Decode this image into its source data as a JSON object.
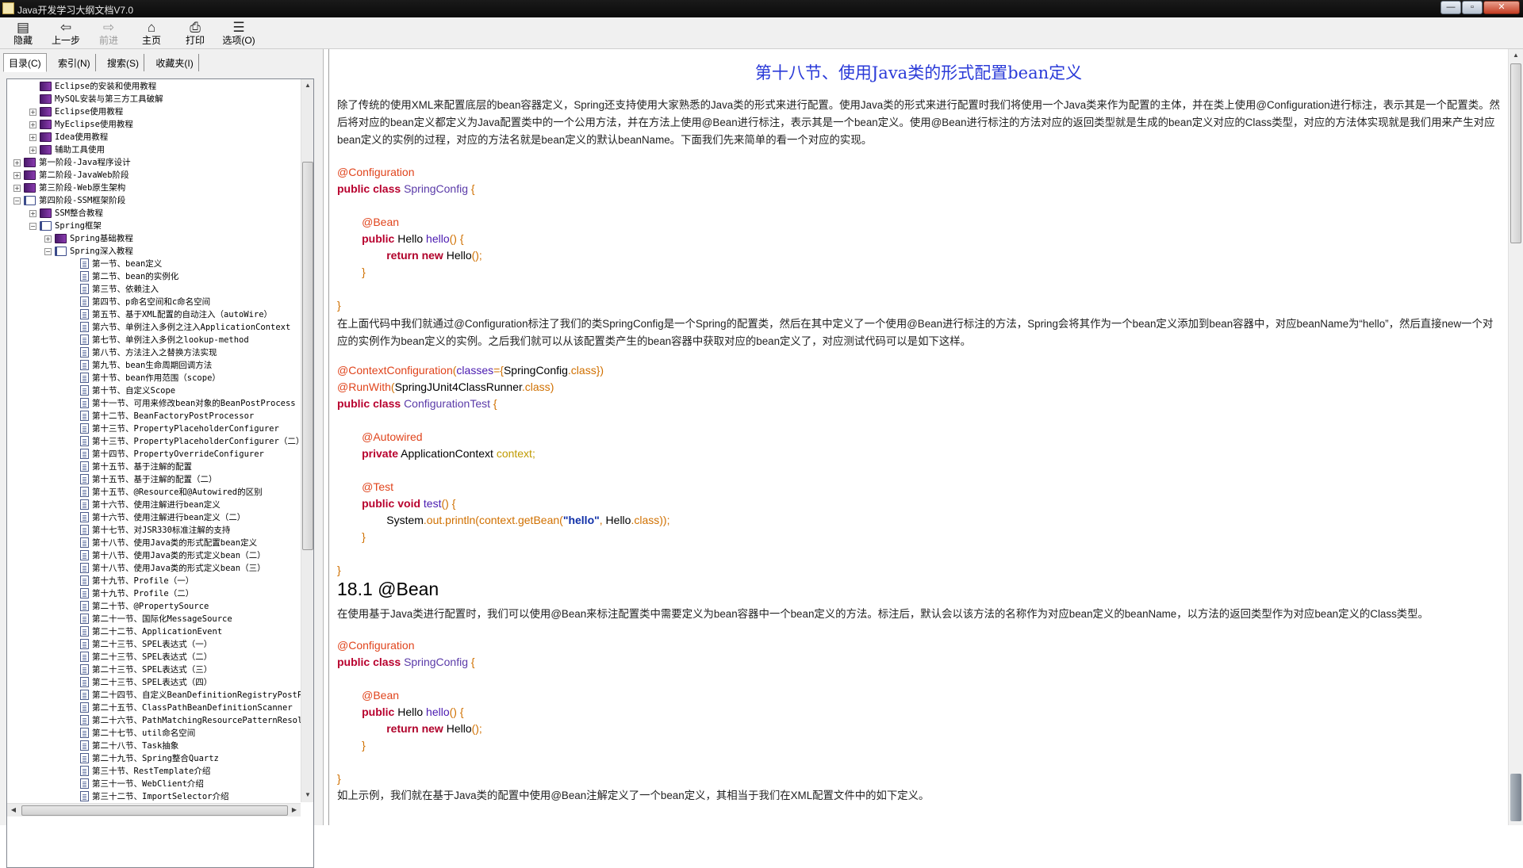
{
  "window": {
    "title": "Java开发学习大纲文档V7.0",
    "min": "—",
    "max": "▫",
    "close": "✕"
  },
  "toolbar": [
    {
      "label": "隐藏",
      "icon": "hide-icon",
      "glyph": "▤"
    },
    {
      "label": "上一步",
      "icon": "back-arrow-icon",
      "glyph": "⇦"
    },
    {
      "label": "前进",
      "icon": "forward-arrow-icon",
      "glyph": "⇨"
    },
    {
      "label": "主页",
      "icon": "home-icon",
      "glyph": "⌂"
    },
    {
      "label": "打印",
      "icon": "print-icon",
      "glyph": "⎙"
    },
    {
      "label": "选项(O)",
      "icon": "options-icon",
      "glyph": "☰"
    }
  ],
  "tabs": [
    "目录(C)",
    "索引(N)",
    "搜索(S)",
    "收藏夹(I)"
  ],
  "tree": [
    {
      "label": "Eclipse的安装和使用教程",
      "level": 2,
      "type": "book",
      "expander": ""
    },
    {
      "label": "MySQL安装与第三方工具破解",
      "level": 2,
      "type": "book",
      "expander": ""
    },
    {
      "label": "Eclipse使用教程",
      "level": 2,
      "type": "book",
      "expander": "+"
    },
    {
      "label": "MyEclipse使用教程",
      "level": 2,
      "type": "book",
      "expander": "+"
    },
    {
      "label": "Idea使用教程",
      "level": 2,
      "type": "book",
      "expander": "+"
    },
    {
      "label": "辅助工具使用",
      "level": 2,
      "type": "book",
      "expander": "+"
    },
    {
      "label": "第一阶段-Java程序设计",
      "level": 1,
      "type": "book",
      "expander": "+"
    },
    {
      "label": "第二阶段-JavaWeb阶段",
      "level": 1,
      "type": "book",
      "expander": "+"
    },
    {
      "label": "第三阶段-Web原生架构",
      "level": 1,
      "type": "book",
      "expander": "+"
    },
    {
      "label": "第四阶段-SSM框架阶段",
      "level": 1,
      "type": "open",
      "expander": "−"
    },
    {
      "label": "SSM整合教程",
      "level": 2,
      "type": "book",
      "expander": "+"
    },
    {
      "label": "Spring框架",
      "level": 2,
      "type": "open",
      "expander": "−"
    },
    {
      "label": "Spring基础教程",
      "level": 3,
      "type": "book",
      "expander": "+"
    },
    {
      "label": "Spring深入教程",
      "level": 3,
      "type": "open",
      "expander": "−"
    },
    {
      "label": "第一节、bean定义",
      "level": 4,
      "type": "page"
    },
    {
      "label": "第二节、bean的实例化",
      "level": 4,
      "type": "page"
    },
    {
      "label": "第三节、依赖注入",
      "level": 4,
      "type": "page"
    },
    {
      "label": "第四节、p命名空间和c命名空间",
      "level": 4,
      "type": "page"
    },
    {
      "label": "第五节、基于XML配置的自动注入（autoWire）",
      "level": 4,
      "type": "page"
    },
    {
      "label": "第六节、单例注入多例之注入ApplicationContext",
      "level": 4,
      "type": "page"
    },
    {
      "label": "第七节、单例注入多例之lookup-method",
      "level": 4,
      "type": "page"
    },
    {
      "label": "第八节、方法注入之替换方法实现",
      "level": 4,
      "type": "page"
    },
    {
      "label": "第九节、bean生命周期回调方法",
      "level": 4,
      "type": "page"
    },
    {
      "label": "第十节、bean作用范围（scope）",
      "level": 4,
      "type": "page"
    },
    {
      "label": "第十节、自定义Scope",
      "level": 4,
      "type": "page"
    },
    {
      "label": "第十一节、可用来修改bean对象的BeanPostProcess",
      "level": 4,
      "type": "page"
    },
    {
      "label": "第十二节、BeanFactoryPostProcessor",
      "level": 4,
      "type": "page"
    },
    {
      "label": "第十三节、PropertyPlaceholderConfigurer",
      "level": 4,
      "type": "page"
    },
    {
      "label": "第十三节、PropertyPlaceholderConfigurer（二）",
      "level": 4,
      "type": "page"
    },
    {
      "label": "第十四节、PropertyOverrideConfigurer",
      "level": 4,
      "type": "page"
    },
    {
      "label": "第十五节、基于注解的配置",
      "level": 4,
      "type": "page"
    },
    {
      "label": "第十五节、基于注解的配置（二）",
      "level": 4,
      "type": "page"
    },
    {
      "label": "第十五节、@Resource和@Autowired的区别",
      "level": 4,
      "type": "page"
    },
    {
      "label": "第十六节、使用注解进行bean定义",
      "level": 4,
      "type": "page"
    },
    {
      "label": "第十六节、使用注解进行bean定义（二）",
      "level": 4,
      "type": "page"
    },
    {
      "label": "第十七节、对JSR330标准注解的支持",
      "level": 4,
      "type": "page"
    },
    {
      "label": "第十八节、使用Java类的形式配置bean定义",
      "level": 4,
      "type": "page"
    },
    {
      "label": "第十八节、使用Java类的形式定义bean（二）",
      "level": 4,
      "type": "page"
    },
    {
      "label": "第十八节、使用Java类的形式定义bean（三）",
      "level": 4,
      "type": "page"
    },
    {
      "label": "第十九节、Profile（一）",
      "level": 4,
      "type": "page"
    },
    {
      "label": "第十九节、Profile（二）",
      "level": 4,
      "type": "page"
    },
    {
      "label": "第二十节、@PropertySource",
      "level": 4,
      "type": "page"
    },
    {
      "label": "第二十一节、国际化MessageSource",
      "level": 4,
      "type": "page"
    },
    {
      "label": "第二十二节、ApplicationEvent",
      "level": 4,
      "type": "page"
    },
    {
      "label": "第二十三节、SPEL表达式（一）",
      "level": 4,
      "type": "page"
    },
    {
      "label": "第二十三节、SPEL表达式（二）",
      "level": 4,
      "type": "page"
    },
    {
      "label": "第二十三节、SPEL表达式（三）",
      "level": 4,
      "type": "page"
    },
    {
      "label": "第二十三节、SPEL表达式（四）",
      "level": 4,
      "type": "page"
    },
    {
      "label": "第二十四节、自定义BeanDefinitionRegistryPostP",
      "level": 4,
      "type": "page"
    },
    {
      "label": "第二十五节、ClassPathBeanDefinitionScanner",
      "level": 4,
      "type": "page"
    },
    {
      "label": "第二十六节、PathMatchingResourcePatternResolv",
      "level": 4,
      "type": "page"
    },
    {
      "label": "第二十七节、util命名空间",
      "level": 4,
      "type": "page"
    },
    {
      "label": "第二十八节、Task抽象",
      "level": 4,
      "type": "page"
    },
    {
      "label": "第二十九节、Spring整合Quartz",
      "level": 4,
      "type": "page"
    },
    {
      "label": "第三十节、RestTemplate介绍",
      "level": 4,
      "type": "page"
    },
    {
      "label": "第三十一节、WebClient介绍",
      "level": 4,
      "type": "page"
    },
    {
      "label": "第三十二节、ImportSelector介绍",
      "level": 4,
      "type": "page"
    }
  ],
  "content": {
    "title": "第十八节、使用Java类的形式配置bean定义",
    "para1": "除了传统的使用XML来配置底层的bean容器定义，Spring还支持使用大家熟悉的Java类的形式来进行配置。使用Java类的形式来进行配置时我们将使用一个Java类来作为配置的主体，并在类上使用@Configuration进行标注，表示其是一个配置类。然后将对应的bean定义都定义为Java配置类中的一个公用方法，并在方法上使用@Bean进行标注，表示其是一个bean定义。使用@Bean进行标注的方法对应的返回类型就是生成的bean定义对应的Class类型，对应的方法体实现就是我们用来产生对应bean定义的实例的过程，对应的方法名就是bean定义的默认beanName。下面我们先来简单的看一个对应的实现。",
    "para2": "在上面代码中我们就通过@Configuration标注了我们的类SpringConfig是一个Spring的配置类，然后在其中定义了一个使用@Bean进行标注的方法，Spring会将其作为一个bean定义添加到bean容器中，对应beanName为“hello”，然后直接new一个对应的实例作为bean定义的实例。之后我们就可以从该配置类产生的bean容器中获取对应的bean定义了，对应测试代码可以是如下这样。",
    "h2": "18.1 @Bean",
    "para3": "在使用基于Java类进行配置时，我们可以使用@Bean来标注配置类中需要定义为bean容器中一个bean定义的方法。标注后，默认会以该方法的名称作为对应bean定义的beanName，以方法的返回类型作为对应bean定义的Class类型。",
    "para4": "如上示例，我们就在基于Java类的配置中使用@Bean注解定义了一个bean定义，其相当于我们在XML配置文件中的如下定义。",
    "code1": {
      "annConfig": "@Configuration",
      "public": "public",
      "class": "class",
      "className": "SpringConfig",
      "open": "{",
      "annBean": "@Bean",
      "type": "Hello",
      "method": "hello",
      "parens": "()",
      "ret": "return",
      "new": "new",
      "ctor": "Hello",
      "ctorEnd": "();",
      "close": "}"
    },
    "code2": {
      "annCtx": "@ContextConfiguration",
      "lp": "(",
      "classesKw": "classes",
      "eq": "={",
      "cfgName": "SpringConfig",
      "dotClass": ".class",
      "rp": "})",
      "annRun": "@RunWith",
      "runner": "SpringJUnit4ClassRunner",
      "dotClass2": ".class",
      "rp2": ")",
      "public": "public",
      "class": "class",
      "testName": "ConfigurationTest",
      "open": "{",
      "annAuto": "@Autowired",
      "private": "private",
      "ctxType": "ApplicationContext",
      "ctxVar": "context;",
      "annTest": "@Test",
      "void": "void",
      "testMethod": "test",
      "parens": "()",
      "sys": "System",
      "println": ".out.println(context.getBean(",
      "hello": "\"hello\"",
      "comma": ",",
      "helloCls": "Hello",
      "tail": ".class));",
      "close": "}"
    }
  }
}
